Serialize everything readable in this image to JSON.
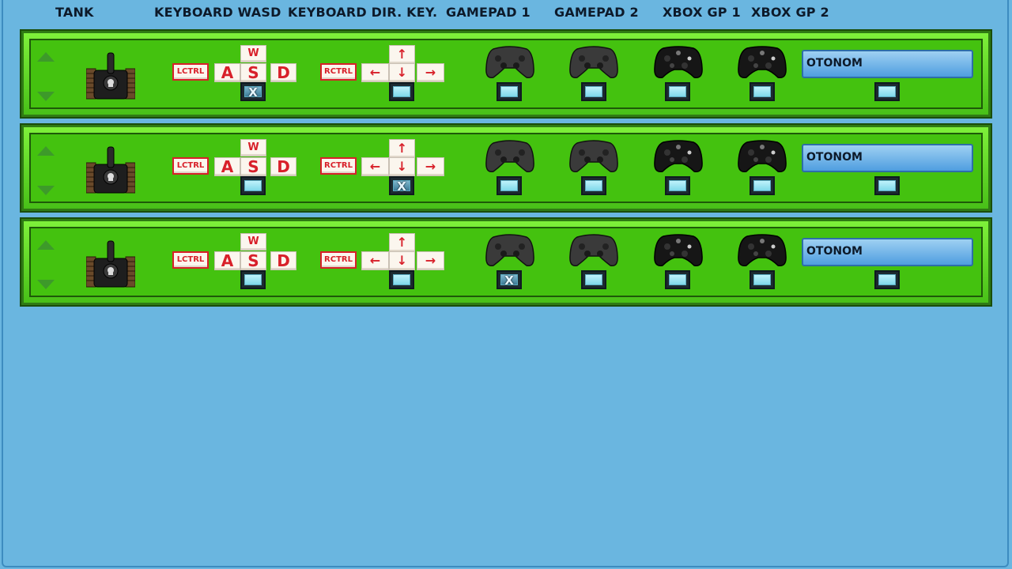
{
  "headers": {
    "tank": "TANK",
    "kb_wasd": "KEYBOARD WASD",
    "kb_dir": "KEYBOARD DIR. KEY.",
    "gp1": "GAMEPAD 1",
    "gp2": "GAMEPAD 2",
    "xbox1": "XBOX GP 1",
    "xbox2": "XBOX GP 2"
  },
  "keys": {
    "lctrl": "LCTRL",
    "rctrl": "RCTRL",
    "w": "W",
    "a": "A",
    "s": "S",
    "d": "D",
    "up": "↑",
    "down": "↓",
    "left": "←",
    "right": "→"
  },
  "rows": [
    {
      "wasd": "X",
      "dir": "",
      "gp1": "",
      "gp2": "",
      "xbox1": "",
      "xbox2": "",
      "auto": "",
      "auto_label": "OTONOM"
    },
    {
      "wasd": "",
      "dir": "X",
      "gp1": "",
      "gp2": "",
      "xbox1": "",
      "xbox2": "",
      "auto": "",
      "auto_label": "OTONOM"
    },
    {
      "wasd": "",
      "dir": "",
      "gp1": "X",
      "gp2": "",
      "xbox1": "",
      "xbox2": "",
      "auto": "",
      "auto_label": "OTONOM"
    }
  ],
  "icons": {
    "up": "triangle-up-icon",
    "down": "triangle-down-icon",
    "tank": "tank-icon",
    "gamepad": "gamepad-icon",
    "xbox": "xbox-controller-icon"
  },
  "colors": {
    "background": "#6ab6e0",
    "row_green": "#44c20f",
    "key_red": "#d8202a",
    "button_blue": "#4f9ee0"
  }
}
